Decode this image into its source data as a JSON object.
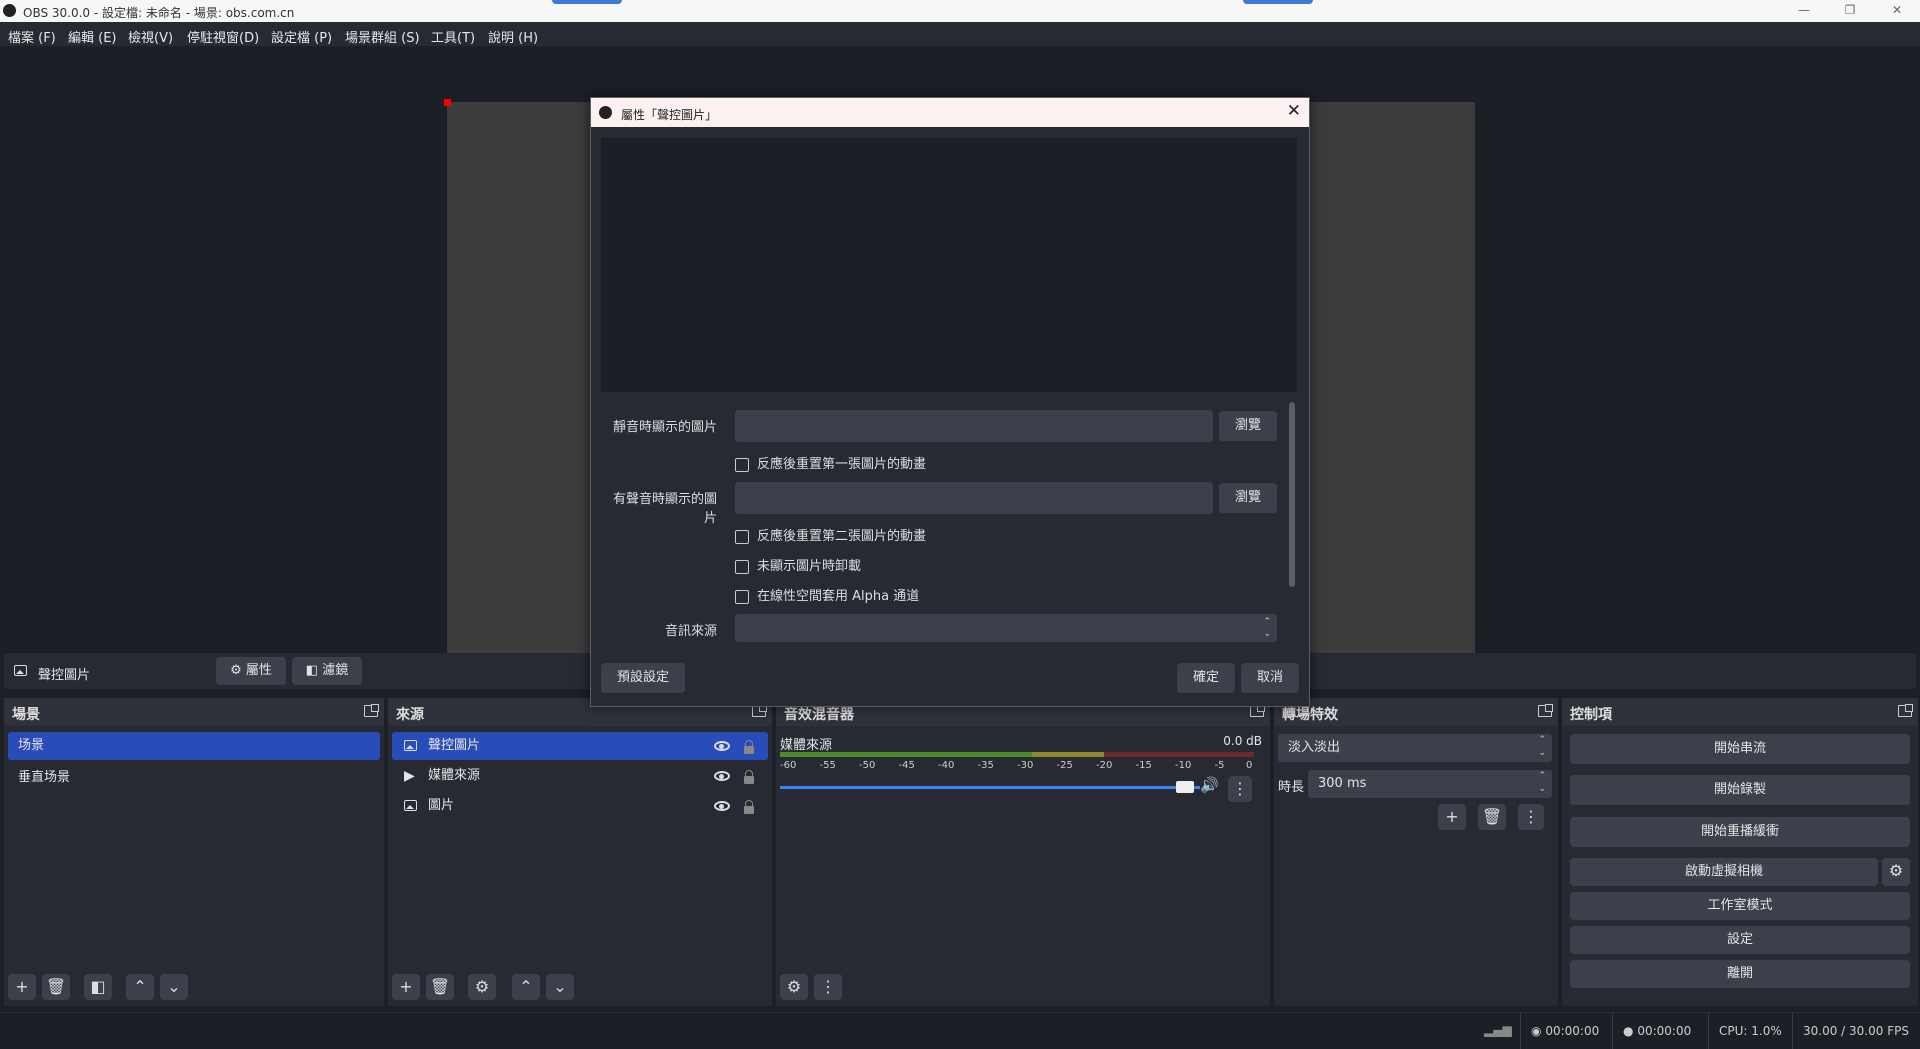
{
  "window": {
    "title": "OBS 30.0.0 - 設定檔: 未命名 - 場景: obs.com.cn",
    "minimize": "—",
    "maximize": "❐",
    "close": "✕"
  },
  "menu": [
    "檔案 (F)",
    "編輯 (E)",
    "檢視(V)",
    "停駐視窗(D)",
    "設定檔 (P)",
    "場景群組 (S)",
    "工具(T)",
    "說明 (H)"
  ],
  "source_bar": {
    "name": "聲控圖片",
    "properties": "屬性",
    "filters": "濾鏡"
  },
  "scenes": {
    "title": "場景",
    "items": [
      "场景",
      "垂直场景"
    ]
  },
  "sources": {
    "title": "來源",
    "items": [
      "聲控圖片",
      "媒體來源",
      "圖片"
    ]
  },
  "mixer": {
    "title": "音效混音器",
    "channel": "媒體來源",
    "level": "0.0 dB",
    "ticks": [
      "-60",
      "-55",
      "-50",
      "-45",
      "-40",
      "-35",
      "-30",
      "-25",
      "-20",
      "-15",
      "-10",
      "-5",
      "0"
    ]
  },
  "transitions": {
    "title": "轉場特效",
    "selected": "淡入淡出",
    "duration_label": "時長",
    "duration": "300 ms"
  },
  "controls": {
    "title": "控制項",
    "buttons": [
      "開始串流",
      "開始錄製",
      "開始重播緩衝",
      "啟動虛擬相機",
      "工作室模式",
      "設定",
      "離開"
    ]
  },
  "status": {
    "stream_time": "00:00:00",
    "rec_time": "00:00:00",
    "cpu": "CPU: 1.0%",
    "fps": "30.00 / 30.00 FPS"
  },
  "dialog": {
    "title": "屬性「聲控圖片」",
    "silent_image_label": "靜音時顯示的圖片",
    "sound_image_label": "有聲音時顯示的圖片",
    "browse": "瀏覽",
    "cb1": "反應後重置第一張圖片的動畫",
    "cb2": "反應後重置第二張圖片的動畫",
    "cb3": "未顯示圖片時卸載",
    "cb4": "在線性空間套用 Alpha 通道",
    "audio_source_label": "音訊來源",
    "defaults": "預設設定",
    "ok": "確定",
    "cancel": "取消"
  }
}
